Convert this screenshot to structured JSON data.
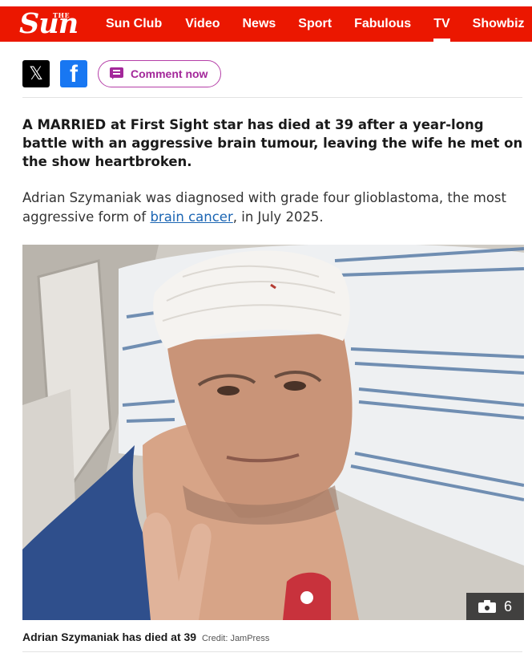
{
  "header": {
    "logo_text": "Sun",
    "logo_superscript": "THE",
    "brand_color": "#eb1700",
    "nav": [
      {
        "label": "Sun Club",
        "active": false
      },
      {
        "label": "Video",
        "active": false
      },
      {
        "label": "News",
        "active": false
      },
      {
        "label": "Sport",
        "active": false
      },
      {
        "label": "Fabulous",
        "active": false
      },
      {
        "label": "TV",
        "active": true
      },
      {
        "label": "Showbiz",
        "active": false
      }
    ]
  },
  "share": {
    "x_icon": "x-logo-icon",
    "facebook_icon": "facebook-icon",
    "comment_label": "Comment now",
    "comment_icon": "comment-bubble-icon",
    "accent_color": "#a3289a"
  },
  "article": {
    "standfirst": "A MARRIED at First Sight star has died at 39 after a year-long battle with an aggressive brain tumour, leaving the wife he met on the show heartbroken.",
    "para_before_link": "Adrian Szymaniak was diagnosed with grade four glioblastoma, the most aggressive form of ",
    "para_link": "brain cancer",
    "para_after_link": ", in July 2025.",
    "image": {
      "gallery_icon": "camera-icon",
      "gallery_count": "6",
      "caption": "Adrian Szymaniak has died at 39",
      "credit": "Credit: JamPress"
    }
  }
}
